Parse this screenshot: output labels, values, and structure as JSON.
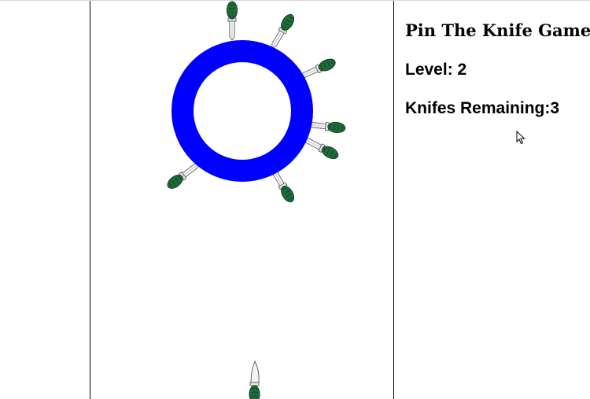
{
  "panel": {
    "title": "Pin The Knife Game",
    "level_label": "Level: ",
    "level_value": "2",
    "knives_label": "Knifes Remaining:",
    "knives_value": "3"
  },
  "colors": {
    "ring": "#0000ff",
    "handle": "#1f6b3a",
    "handle_dark": "#0d3d1f",
    "blade": "#f2f2f2",
    "blade_edge": "#555555"
  },
  "icons": {
    "cursor": "mouse-pointer-icon",
    "knife": "knife-icon"
  },
  "game": {
    "stuck_knives": 7,
    "ready_knives": 1
  }
}
